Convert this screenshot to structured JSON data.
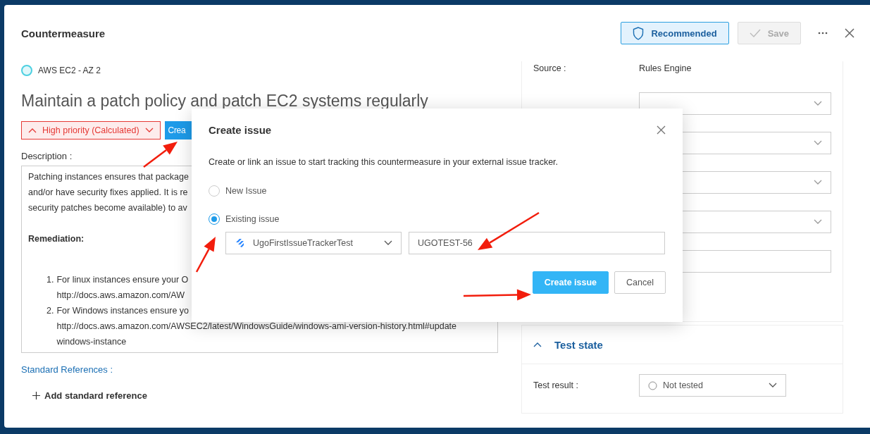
{
  "window": {
    "title": "Countermeasure",
    "actions": [
      {
        "kind": "recommended",
        "label": "Recommended",
        "disabled": false
      },
      {
        "kind": "save",
        "label": "Save",
        "disabled": true
      }
    ]
  },
  "asset": {
    "label": "AWS EC2 - AZ 2"
  },
  "countermeasure": {
    "title": "Maintain a patch policy and patch EC2 systems regularly",
    "priority": "High priority (Calculated)",
    "create_button": "Crea"
  },
  "description": {
    "label": "Description :",
    "paragraph": [
      "Patching instances ensures that package",
      "and/or have security fixes applied. It is re",
      "security patches become available) to av"
    ],
    "remediation": "Remediation:",
    "steps": [
      {
        "number": "1.",
        "lines": [
          "For linux instances ensure your O",
          "http://docs.aws.amazon.com/AW"
        ]
      },
      {
        "number": "2.",
        "lines": [
          "For Windows instances ensure yo",
          "http://docs.aws.amazon.com/AWSEC2/latest/WindowsGuide/windows-ami-version-history.html#update",
          "windows-instance"
        ]
      }
    ]
  },
  "standard_references": {
    "label": "Standard References :",
    "add": "Add standard reference"
  },
  "details": {
    "source_label": "Source :",
    "source_value": "Rules Engine",
    "fields": [
      {
        "kind": "select"
      },
      {
        "kind": "select"
      },
      {
        "kind": "select"
      },
      {
        "kind": "select"
      },
      {
        "kind": "input"
      }
    ]
  },
  "test_state": {
    "title": "Test state",
    "expanded": true,
    "result_label": "Test result :",
    "result_value": "Not tested"
  },
  "dialog": {
    "title": "Create issue",
    "intro": "Create or link an issue to start tracking this countermeasure in your external issue tracker.",
    "options": [
      {
        "label": "New Issue",
        "selected": false
      },
      {
        "label": "Existing issue",
        "selected": true
      }
    ],
    "tracker": "UgoFirstIssueTrackerTest",
    "issue_key": "UGOTEST-56",
    "buttons": [
      {
        "kind": "primary",
        "label": "Create issue"
      },
      {
        "kind": "secondary",
        "label": "Cancel"
      }
    ]
  }
}
